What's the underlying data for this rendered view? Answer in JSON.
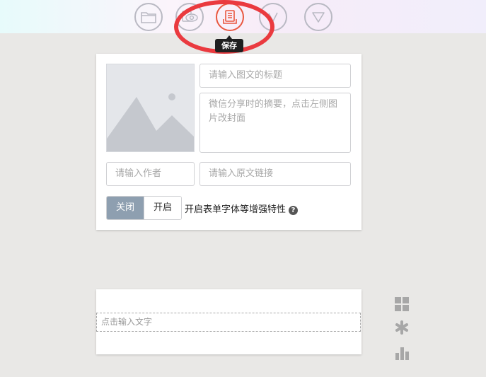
{
  "toolbar": {
    "buttons": [
      {
        "icon": "folder-icon",
        "label": ""
      },
      {
        "icon": "eye-icon",
        "label": ""
      },
      {
        "icon": "save-document-icon",
        "label": ""
      },
      {
        "icon": "check-icon",
        "label": ""
      },
      {
        "icon": "triangle-down-icon",
        "label": ""
      }
    ],
    "active_color": "#e9573f",
    "save_tooltip": "保存",
    "highlight_color": "#ea3a3f"
  },
  "form": {
    "cover_icon": "image-placeholder-icon",
    "title_placeholder": "请输入图文的标题",
    "summary_placeholder": "微信分享时的摘要，点击左侧图片改封面",
    "author_placeholder": "请输入作者",
    "source_placeholder": "请输入原文链接",
    "toggle": {
      "off_label": "关闭",
      "on_label": "开启",
      "selected": "关闭"
    },
    "enhance_label": "开启表单字体等增强特性",
    "help_icon": "?"
  },
  "editor": {
    "placeholder": "点击输入文字"
  },
  "side_tools": [
    {
      "icon": "grid-icon"
    },
    {
      "icon": "asterisk-icon"
    },
    {
      "icon": "bar-chart-icon"
    }
  ]
}
